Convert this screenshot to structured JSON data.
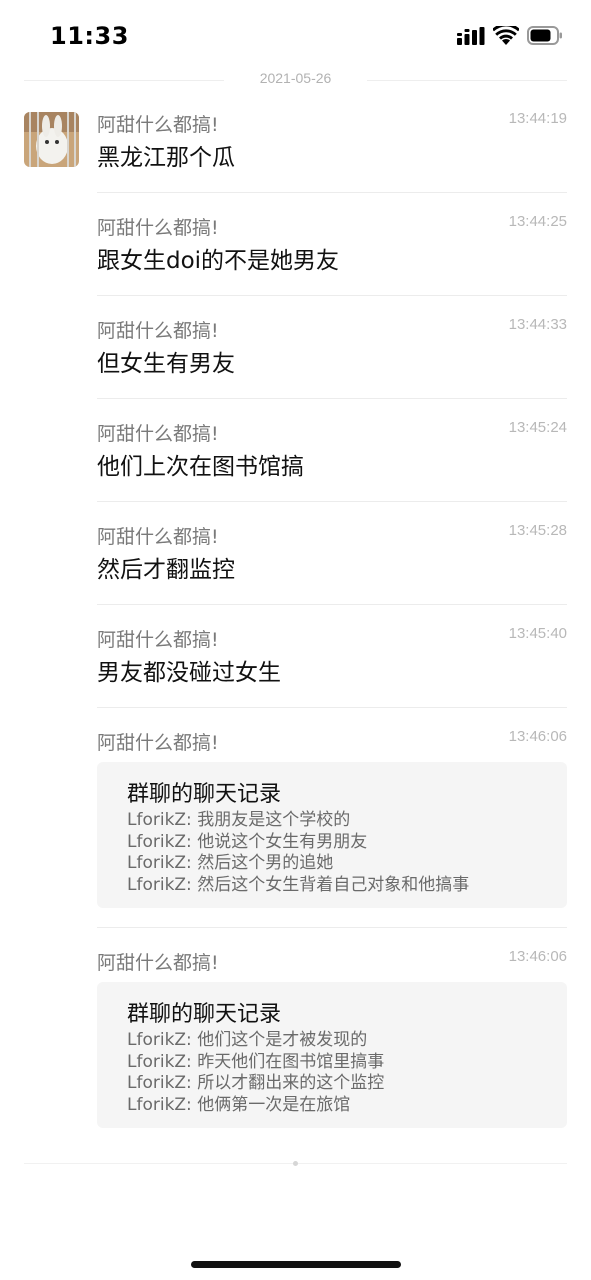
{
  "status_bar": {
    "time": "11:33"
  },
  "date_separator": "2021-05-26",
  "messages": [
    {
      "sender": "阿甜什么都搞!",
      "time": "13:44:19",
      "text": "黑龙江那个瓜"
    },
    {
      "sender": "阿甜什么都搞!",
      "time": "13:44:25",
      "text": "跟女生doi的不是她男友"
    },
    {
      "sender": "阿甜什么都搞!",
      "time": "13:44:33",
      "text": "但女生有男友"
    },
    {
      "sender": "阿甜什么都搞!",
      "time": "13:45:24",
      "text": "他们上次在图书馆搞"
    },
    {
      "sender": "阿甜什么都搞!",
      "time": "13:45:28",
      "text": "然后才翻监控"
    },
    {
      "sender": "阿甜什么都搞!",
      "time": "13:45:40",
      "text": "男友都没碰过女生"
    },
    {
      "sender": "阿甜什么都搞!",
      "time": "13:46:06",
      "card": {
        "title": "群聊的聊天记录",
        "lines": [
          "LforikZ: 我朋友是这个学校的",
          "LforikZ: 他说这个女生有男朋友",
          "LforikZ: 然后这个男的追她",
          "LforikZ: 然后这个女生背着自己对象和他搞事"
        ]
      }
    },
    {
      "sender": "阿甜什么都搞!",
      "time": "13:46:06",
      "card": {
        "title": "群聊的聊天记录",
        "lines": [
          "LforikZ: 他们这个是才被发现的",
          "LforikZ: 昨天他们在图书馆里搞事",
          "LforikZ: 所以才翻出来的这个监控",
          "LforikZ: 他俩第一次是在旅馆"
        ]
      }
    }
  ],
  "colors": {
    "background": "#ffffff",
    "card": "#f5f5f5",
    "name_gray": "#7a7a7a",
    "time_gray": "#b8b8b8"
  },
  "icons": [
    "cellular-signal-icon",
    "wifi-icon",
    "battery-icon"
  ]
}
